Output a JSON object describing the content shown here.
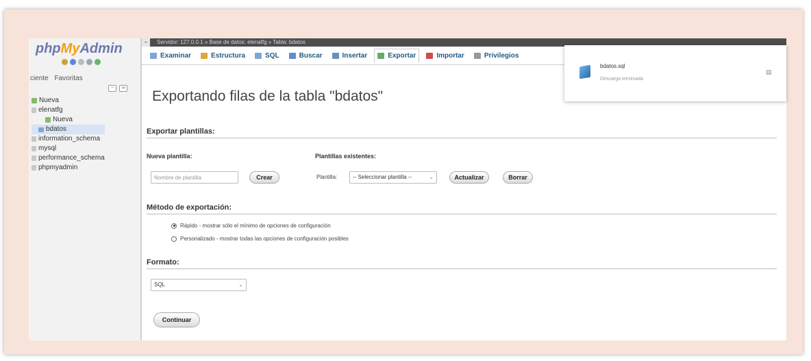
{
  "sidebar": {
    "logo_php": "php",
    "logo_my": "My",
    "logo_admin": "Admin",
    "links": [
      "ciente",
      "Favoritas"
    ],
    "tree": [
      {
        "label": "Nueva",
        "kind": "new",
        "indent": 0
      },
      {
        "label": "elenatfg",
        "kind": "db",
        "indent": 0
      },
      {
        "label": "Nueva",
        "kind": "new",
        "indent": 2
      },
      {
        "label": "bdatos",
        "kind": "table",
        "indent": 1,
        "selected": true
      },
      {
        "label": "information_schema",
        "kind": "db",
        "indent": 0
      },
      {
        "label": "mysql",
        "kind": "db",
        "indent": 0
      },
      {
        "label": "performance_schema",
        "kind": "db",
        "indent": 0
      },
      {
        "label": "phpmyadmin",
        "kind": "db",
        "indent": 0
      }
    ]
  },
  "breadcrumb": "Servidor: 127.0.0.1 » Base de datos: elenatfg » Tabla: bdatos",
  "tabs": [
    {
      "label": "Examinar",
      "icon_color": "#7fa6d9"
    },
    {
      "label": "Estructura",
      "icon_color": "#e2a43c"
    },
    {
      "label": "SQL",
      "icon_color": "#7fa6d9"
    },
    {
      "label": "Buscar",
      "icon_color": "#5e8fcf"
    },
    {
      "label": "Insertar",
      "icon_color": "#6a8fb8"
    },
    {
      "label": "Exportar",
      "icon_color": "#6aa86a",
      "active": true
    },
    {
      "label": "Importar",
      "icon_color": "#d24a4a"
    },
    {
      "label": "Privilegios",
      "icon_color": "#999999"
    }
  ],
  "page_title": "Exportando filas de la tabla \"bdatos\"",
  "templates": {
    "section_title": "Exportar plantillas:",
    "new_label": "Nueva plantilla:",
    "new_placeholder": "Nombre de plantilla",
    "create_button": "Crear",
    "existing_label": "Plantillas existentes:",
    "template_label": "Plantilla:",
    "template_select": "-- Seleccionar plantilla --",
    "update_button": "Actualizar",
    "delete_button": "Borrar"
  },
  "export_method": {
    "section_title": "Método de exportación:",
    "options": [
      {
        "label": "Rápido - mostrar sólo el mínimo de opciones de configuración",
        "checked": true
      },
      {
        "label": "Personalizado - mostrar todas las opciones de configuración posibles",
        "checked": false
      }
    ]
  },
  "format": {
    "section_title": "Formato:",
    "selected": "SQL"
  },
  "continue_button": "Continuar",
  "download": {
    "file_name": "bdatos.sql",
    "status": "Descarga terminada"
  }
}
